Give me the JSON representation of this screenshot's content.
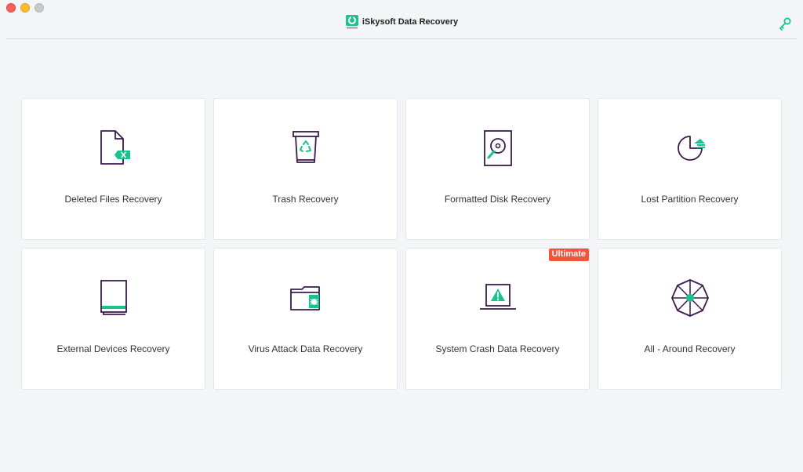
{
  "app": {
    "title": "iSkysoft Data Recovery"
  },
  "colors": {
    "accent": "#19c28e",
    "icon_stroke": "#3a1b4d",
    "badge": "#f1533b"
  },
  "cards": [
    {
      "label": "Deleted Files Recovery",
      "icon": "deleted-file-icon"
    },
    {
      "label": "Trash Recovery",
      "icon": "trash-icon"
    },
    {
      "label": "Formatted Disk Recovery",
      "icon": "hard-disk-icon"
    },
    {
      "label": "Lost Partition Recovery",
      "icon": "partition-icon"
    },
    {
      "label": "External Devices Recovery",
      "icon": "external-device-icon"
    },
    {
      "label": "Virus Attack Data Recovery",
      "icon": "virus-folder-icon"
    },
    {
      "label": "System Crash Data Recovery",
      "icon": "crashed-laptop-icon",
      "badge": "Ultimate"
    },
    {
      "label": "All - Around Recovery",
      "icon": "all-around-icon"
    }
  ]
}
